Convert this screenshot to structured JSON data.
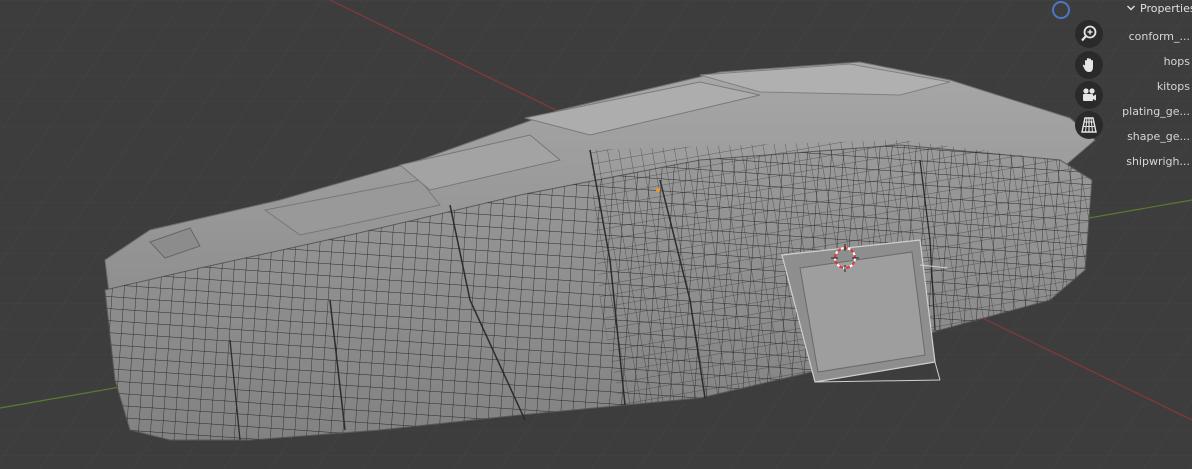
{
  "viewport": {
    "gizmo_color": "#4a77c8",
    "background": "#3d3d3d",
    "mesh_color": "#8a8a8a"
  },
  "tools": [
    {
      "icon": "zoom-icon"
    },
    {
      "icon": "hand-pan-icon"
    },
    {
      "icon": "camera-icon"
    },
    {
      "icon": "grid-perspective-icon"
    }
  ],
  "panel": {
    "header": "Properties",
    "items": [
      {
        "label": "conform_..."
      },
      {
        "label": "hops"
      },
      {
        "label": "kitops"
      },
      {
        "label": "plating_ge..."
      },
      {
        "label": "shape_ge..."
      },
      {
        "label": "shipwrigh..."
      }
    ]
  }
}
